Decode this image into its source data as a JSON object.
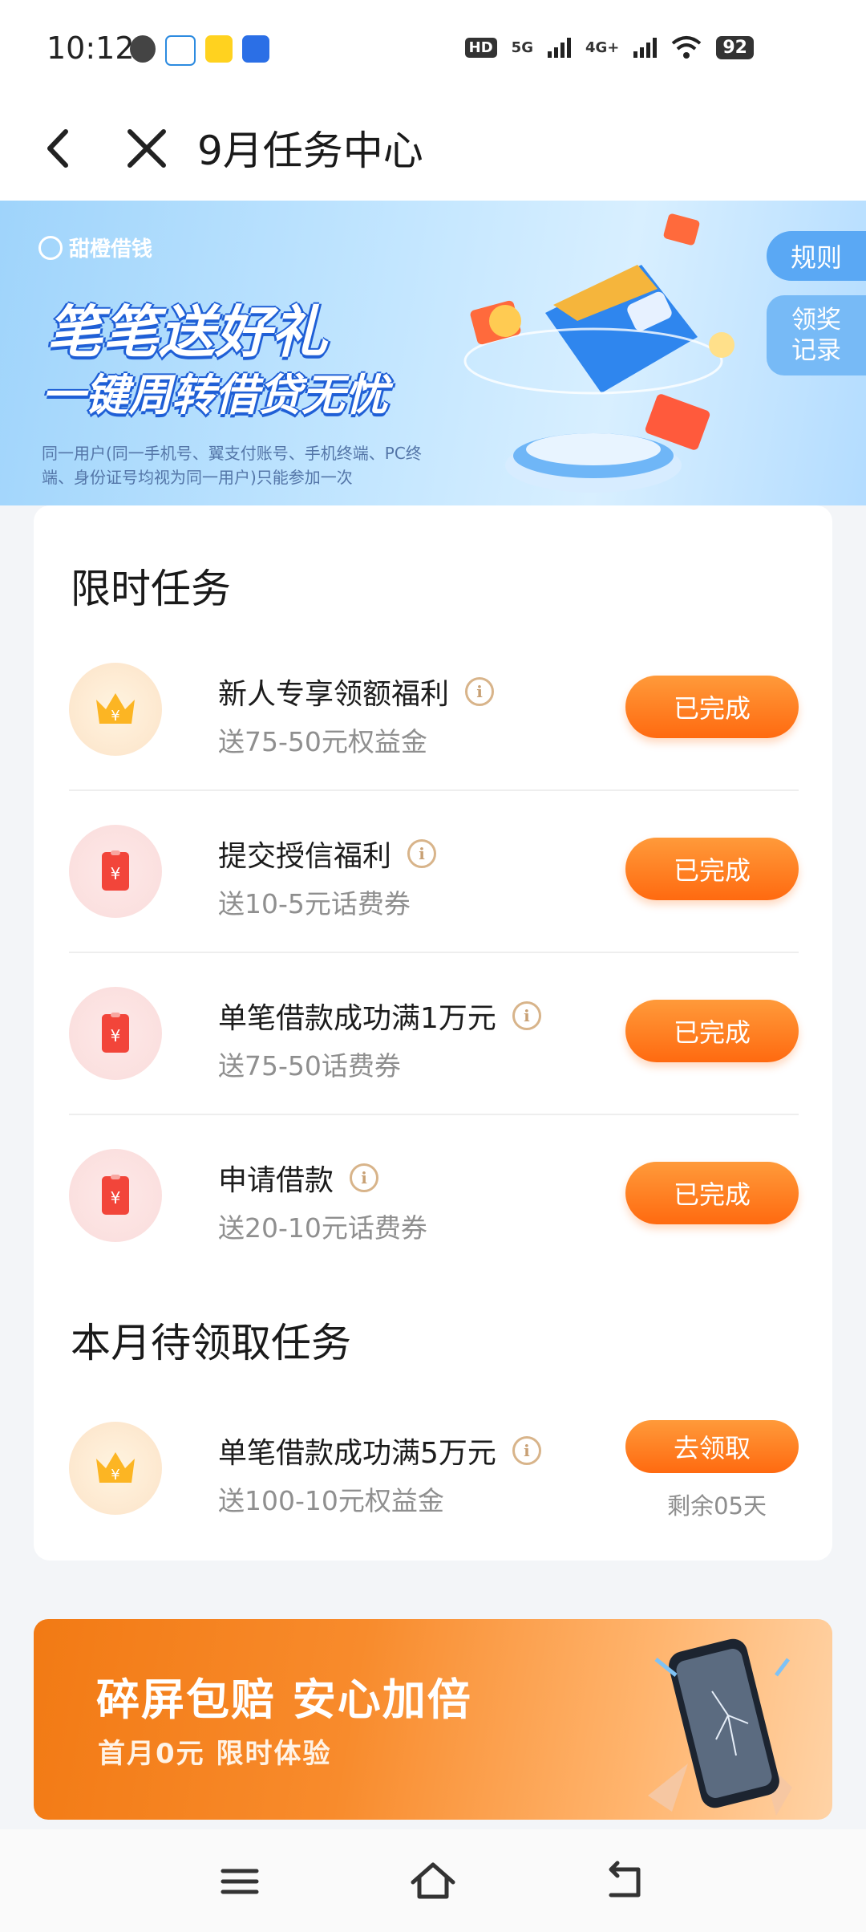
{
  "status_bar": {
    "time": "10:12",
    "notification_icons": [
      "chat-bubble-icon",
      "app-100-icon",
      "app-yellow-icon",
      "app-blue-icon"
    ],
    "hd_label": "HD",
    "signal1_label": "5G",
    "signal2_label": "4G+",
    "battery": "92"
  },
  "header": {
    "title": "9月任务中心",
    "back_icon": "chevron-left-icon",
    "close_icon": "close-icon"
  },
  "banner": {
    "brand": "甜橙借钱",
    "headline_1": "笔笔送好礼",
    "headline_2": "一键周转借贷无忧",
    "disclaimer": "同一用户(同一手机号、翼支付账号、手机终端、PC终端、身份证号均视为同一用户)只能参加一次",
    "rules_label": "规则",
    "record_label_1": "领奖",
    "record_label_2": "记录"
  },
  "limited_tasks": {
    "title": "限时任务",
    "items": [
      {
        "name": "新人专享领额福利",
        "reward": "送75-50元权益金",
        "button": "已完成",
        "icon": "crown-icon"
      },
      {
        "name": "提交授信福利",
        "reward": "送10-5元话费券",
        "button": "已完成",
        "icon": "red-envelope-icon"
      },
      {
        "name": "单笔借款成功满1万元",
        "reward": "送75-50话费券",
        "button": "已完成",
        "icon": "red-envelope-icon"
      },
      {
        "name": "申请借款",
        "reward": "送20-10元话费券",
        "button": "已完成",
        "icon": "red-envelope-icon"
      }
    ]
  },
  "monthly_tasks": {
    "title": "本月待领取任务",
    "items": [
      {
        "name": "单笔借款成功满5万元",
        "reward": "送100-10元权益金",
        "button": "去领取",
        "remaining": "剩余05天",
        "icon": "crown-icon"
      }
    ]
  },
  "info_glyph": "i",
  "promo": {
    "title": "碎屏包赔 安心加倍",
    "subtitle": "首月0元 限时体验"
  },
  "nav_bar": {
    "menu_icon": "menu-icon",
    "home_icon": "home-icon",
    "back_icon": "back-icon"
  },
  "colors": {
    "accent_orange": "#ff7a1f",
    "banner_blue": "#9fd4fb",
    "page_bg": "#f3f5f8"
  }
}
